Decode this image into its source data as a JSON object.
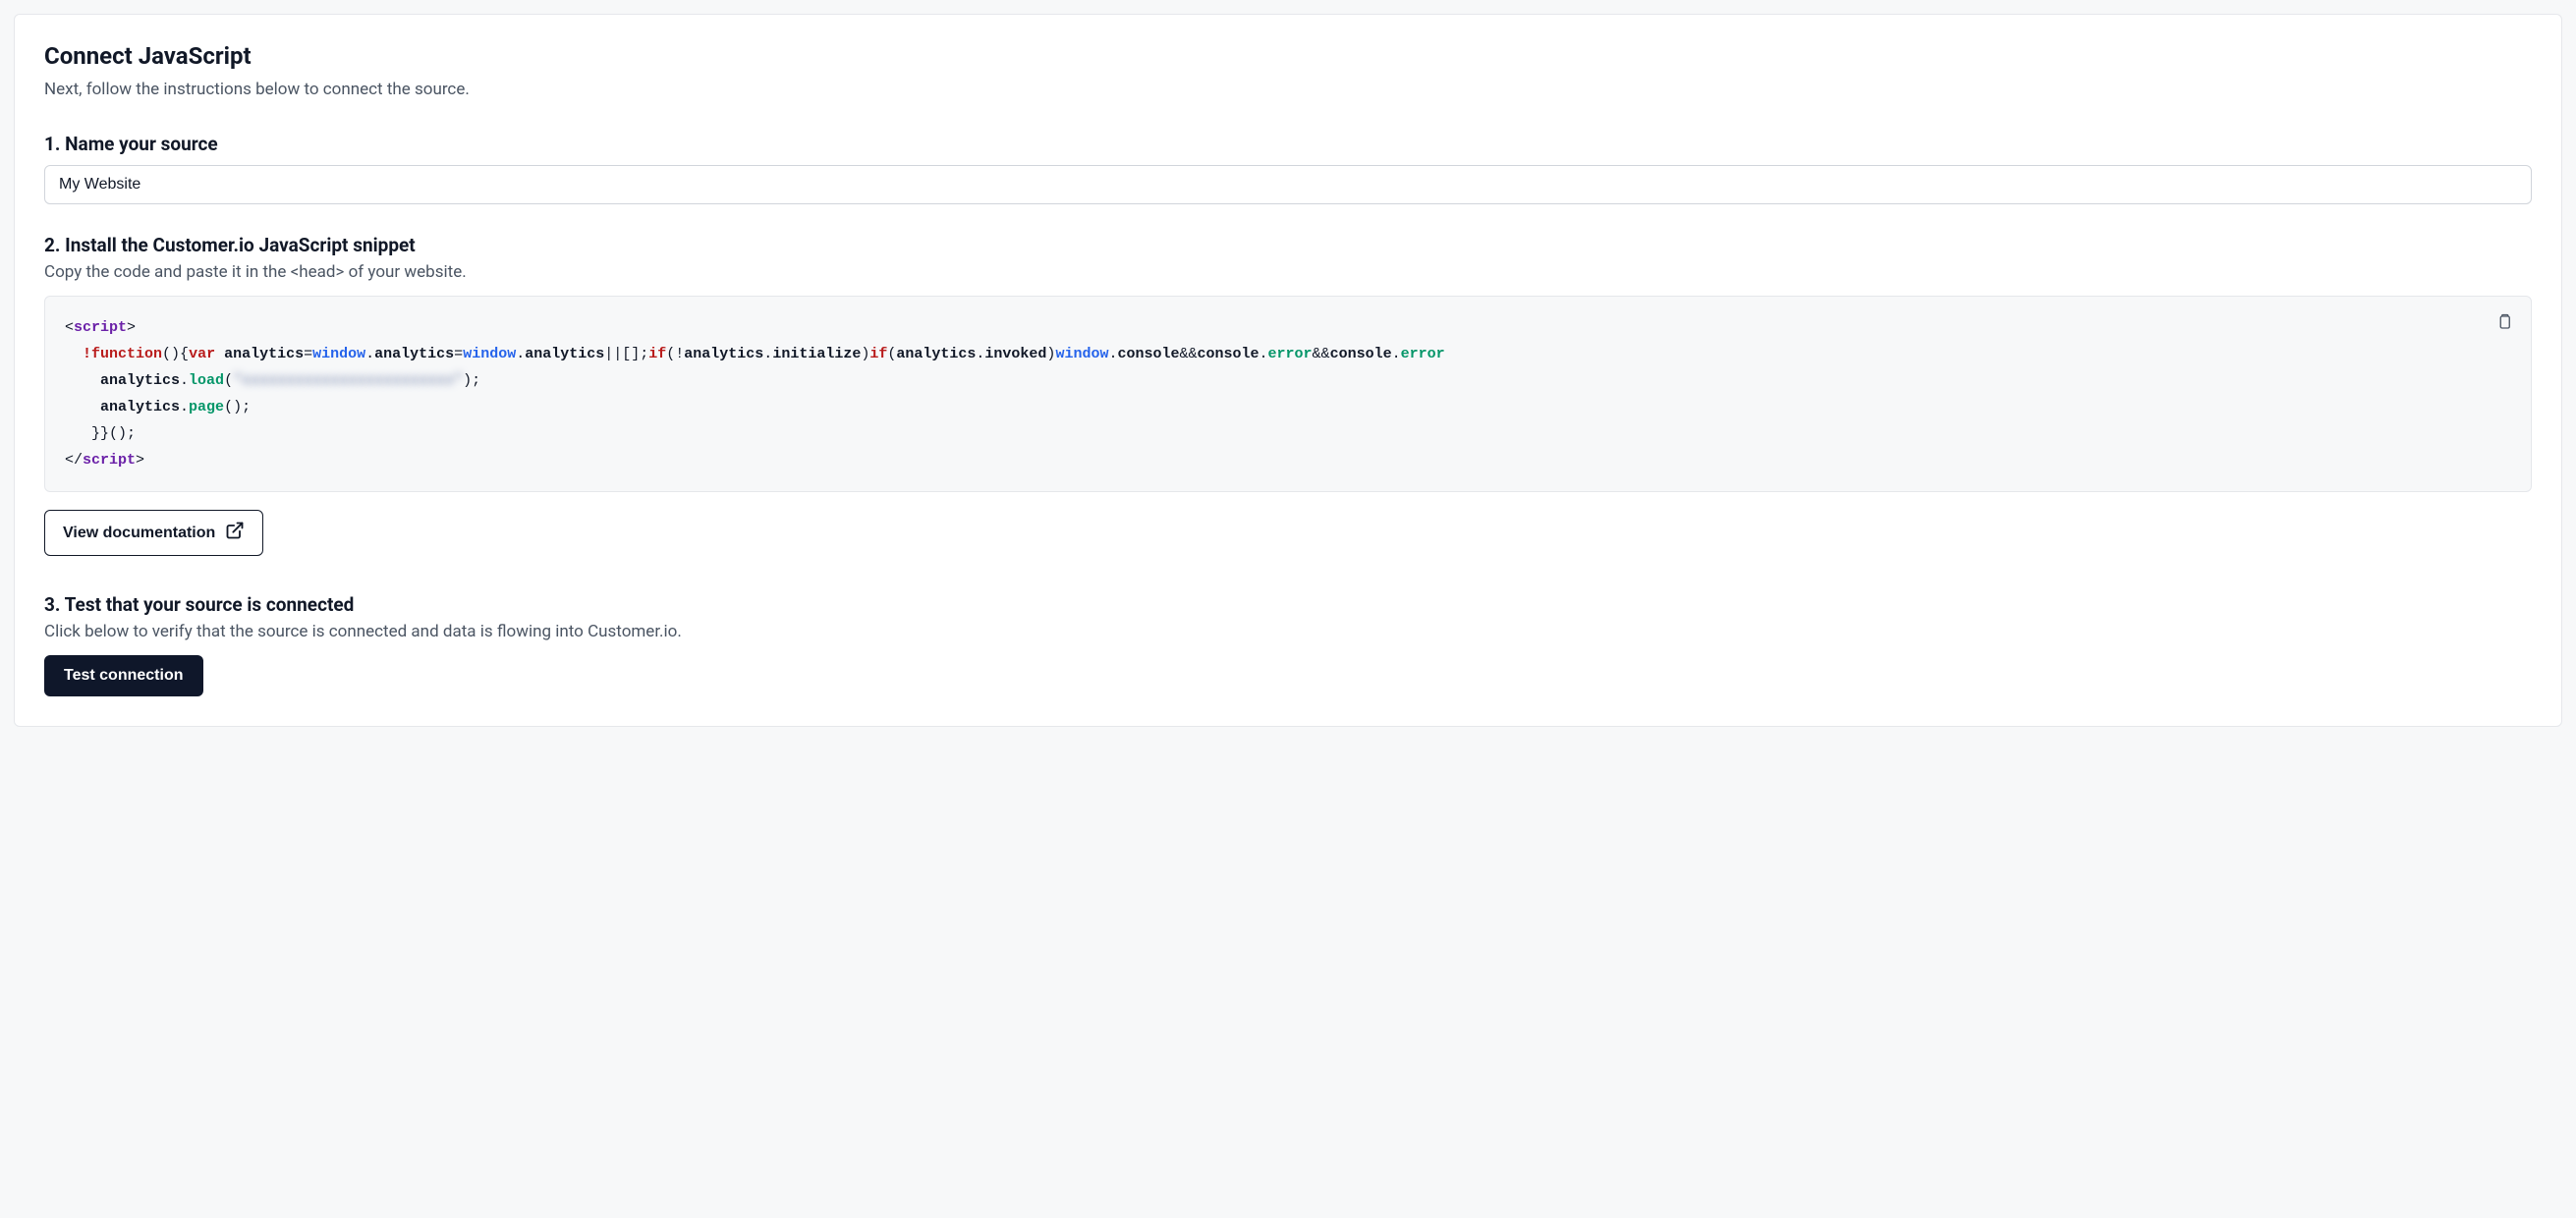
{
  "header": {
    "title": "Connect JavaScript",
    "subtitle": "Next, follow the instructions below to connect the source."
  },
  "step1": {
    "heading": "1. Name your source",
    "input_value": "My Website"
  },
  "step2": {
    "heading": "2. Install the Customer.io JavaScript snippet",
    "subtext": "Copy the code and paste it in the <head> of your website.",
    "code": {
      "line1_open": "<",
      "line1_tag": "script",
      "line1_close": ">",
      "line2_bang": "!",
      "line2_function": "function",
      "line2_paren_open": "(){",
      "line2_var": "var",
      "line2_sp": " ",
      "line2_analytics": "analytics",
      "line2_eq": "=",
      "line2_window": "window",
      "line2_dot": ".",
      "line2_analytics2": "analytics",
      "line2_eq2": "=",
      "line2_window2": "window",
      "line2_dot2": ".",
      "line2_analytics3": "analytics",
      "line2_or": "||[];",
      "line2_if": "if",
      "line2_p1": "(!",
      "line2_analytics4": "analytics",
      "line2_dot3": ".",
      "line2_initialize": "initialize",
      "line2_p2": ")",
      "line2_if2": "if",
      "line2_p3": "(",
      "line2_analytics5": "analytics",
      "line2_dot4": ".",
      "line2_invoked": "invoked",
      "line2_p4": ")",
      "line2_window3": "window",
      "line2_dot5": ".",
      "line2_console": "console",
      "line2_and": "&&",
      "line2_console2": "console",
      "line2_dot6": ".",
      "line2_error": "error",
      "line2_and2": "&&",
      "line2_console3": "console",
      "line2_dot7": ".",
      "line2_error2": "error",
      "line3_analytics": "analytics",
      "line3_dot": ".",
      "line3_load": "load",
      "line3_p1": "(",
      "line3_key_redacted": "\"xxxxxxxxxxxxxxxxxxxxxxxx\"",
      "line3_p2": ");",
      "line4_analytics": "analytics",
      "line4_dot": ".",
      "line4_page": "page",
      "line4_call": "();",
      "line5": "}}();",
      "line6_open": "</",
      "line6_tag": "script",
      "line6_close": ">"
    },
    "view_docs_label": "View documentation"
  },
  "step3": {
    "heading": "3. Test that your source is connected",
    "subtext": "Click below to verify that the source is connected and data is flowing into Customer.io.",
    "button_label": "Test connection"
  }
}
